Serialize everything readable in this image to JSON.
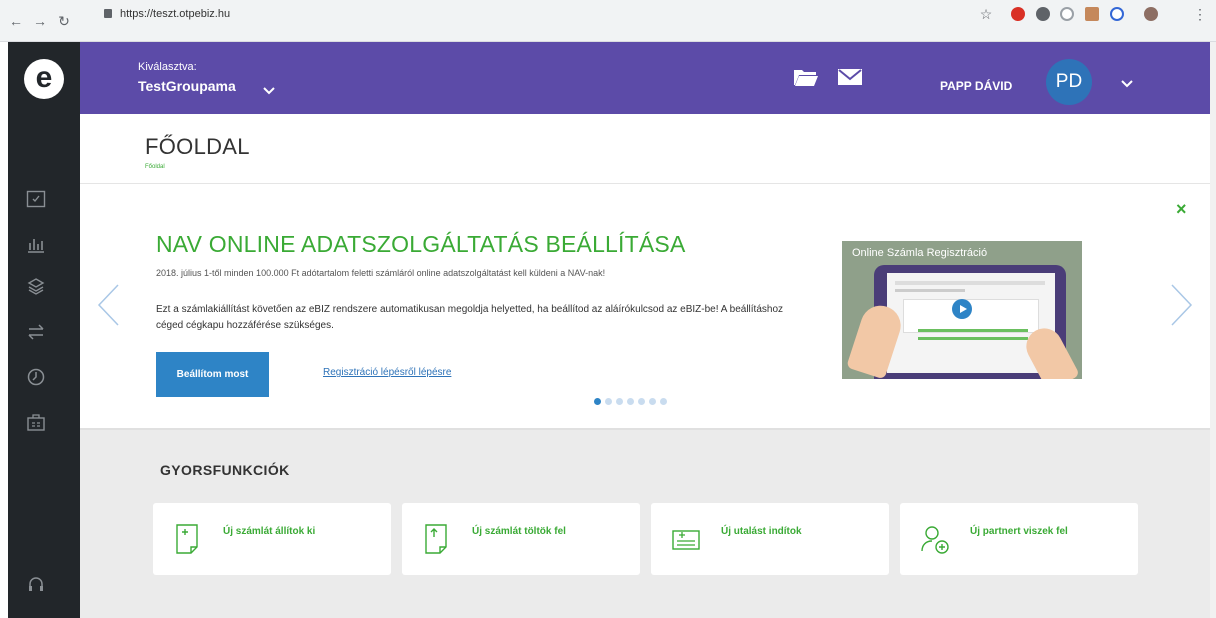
{
  "browser": {
    "url": "https://teszt.otpebiz.hu"
  },
  "colors": {
    "header": "#5c4ba8",
    "accent_green": "#3aaa35",
    "button_blue": "#2e84c6",
    "sidebar": "#22262a"
  },
  "sidebar": {
    "logo": "e",
    "icons": [
      "dashboard-icon",
      "chart-icon",
      "layers-icon",
      "transfer-icon",
      "clock-icon",
      "briefcase-icon",
      "headset-icon"
    ]
  },
  "header": {
    "selected_label": "Kiválasztva:",
    "selected_value": "TestGroupama",
    "user_name": "PAPP DÁVID",
    "avatar_initials": "PD"
  },
  "page": {
    "title": "FŐOLDAL",
    "breadcrumb": "Főoldal"
  },
  "banner": {
    "headline": "NAV ONLINE ADATSZOLGÁLTATÁS BEÁLLÍTÁSA",
    "subline": "2018. július 1-től minden 100.000 Ft adótartalom feletti számláról online adatszolgáltatást kell küldeni a NAV-nak!",
    "description": "Ezt a számlakiállítást követően az eBIZ rendszere automatikusan megoldja helyetted, ha beállítod az aláírókulcsod az eBIZ-be! A beállításhoz céged cégkapu hozzáférése szükséges.",
    "cta_label": "Beállítom most",
    "link_label": "Regisztráció lépésről lépésre",
    "video_title": "Online Számla Regisztráció",
    "slides_total": 7,
    "active_slide": 1
  },
  "quick": {
    "title": "GYORSFUNKCIÓK",
    "cards": [
      {
        "label": "Új számlát állítok ki",
        "icon": "new-invoice-icon"
      },
      {
        "label": "Új számlát töltök fel",
        "icon": "upload-invoice-icon"
      },
      {
        "label": "Új utalást indítok",
        "icon": "new-transfer-icon"
      },
      {
        "label": "Új partnert viszek fel",
        "icon": "add-partner-icon"
      }
    ]
  }
}
